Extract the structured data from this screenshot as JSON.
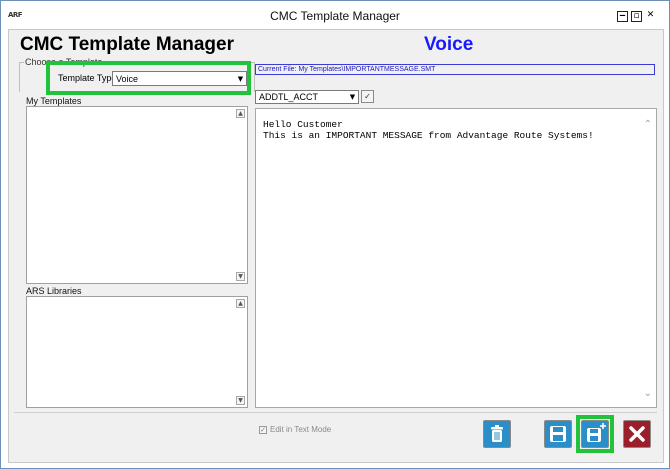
{
  "window": {
    "title": "CMC Template Manager",
    "icon_label": "ARF"
  },
  "header": {
    "title": "CMC Template Manager",
    "mode": "Voice"
  },
  "choose_template": {
    "legend": "Choose a Template",
    "template_type_label": "Template Type",
    "template_type_value": "Voice"
  },
  "my_templates": {
    "label": "My Templates",
    "items": []
  },
  "ars_libraries": {
    "label": "ARS Libraries",
    "items": []
  },
  "current_file": "Current File: My Templates\\IMPORTANTMESSAGE.SMT",
  "field_select": {
    "value": "ADDTL_ACCT"
  },
  "editor": {
    "line1": "Hello Customer",
    "line2": "This is an IMPORTANT MESSAGE from Advantage Route Systems!"
  },
  "footer": {
    "edit_text_mode_label": "Edit in Text Mode",
    "edit_text_mode_checked": true
  },
  "colors": {
    "highlight": "#22c23a",
    "voice_title": "#1a1aff",
    "delete_button": "#2a8fc8",
    "save_button": "#2a8fc8",
    "close_button": "#9a1f2b"
  },
  "icons": [
    "trash-icon",
    "save-icon",
    "save-new-icon",
    "close-icon"
  ]
}
